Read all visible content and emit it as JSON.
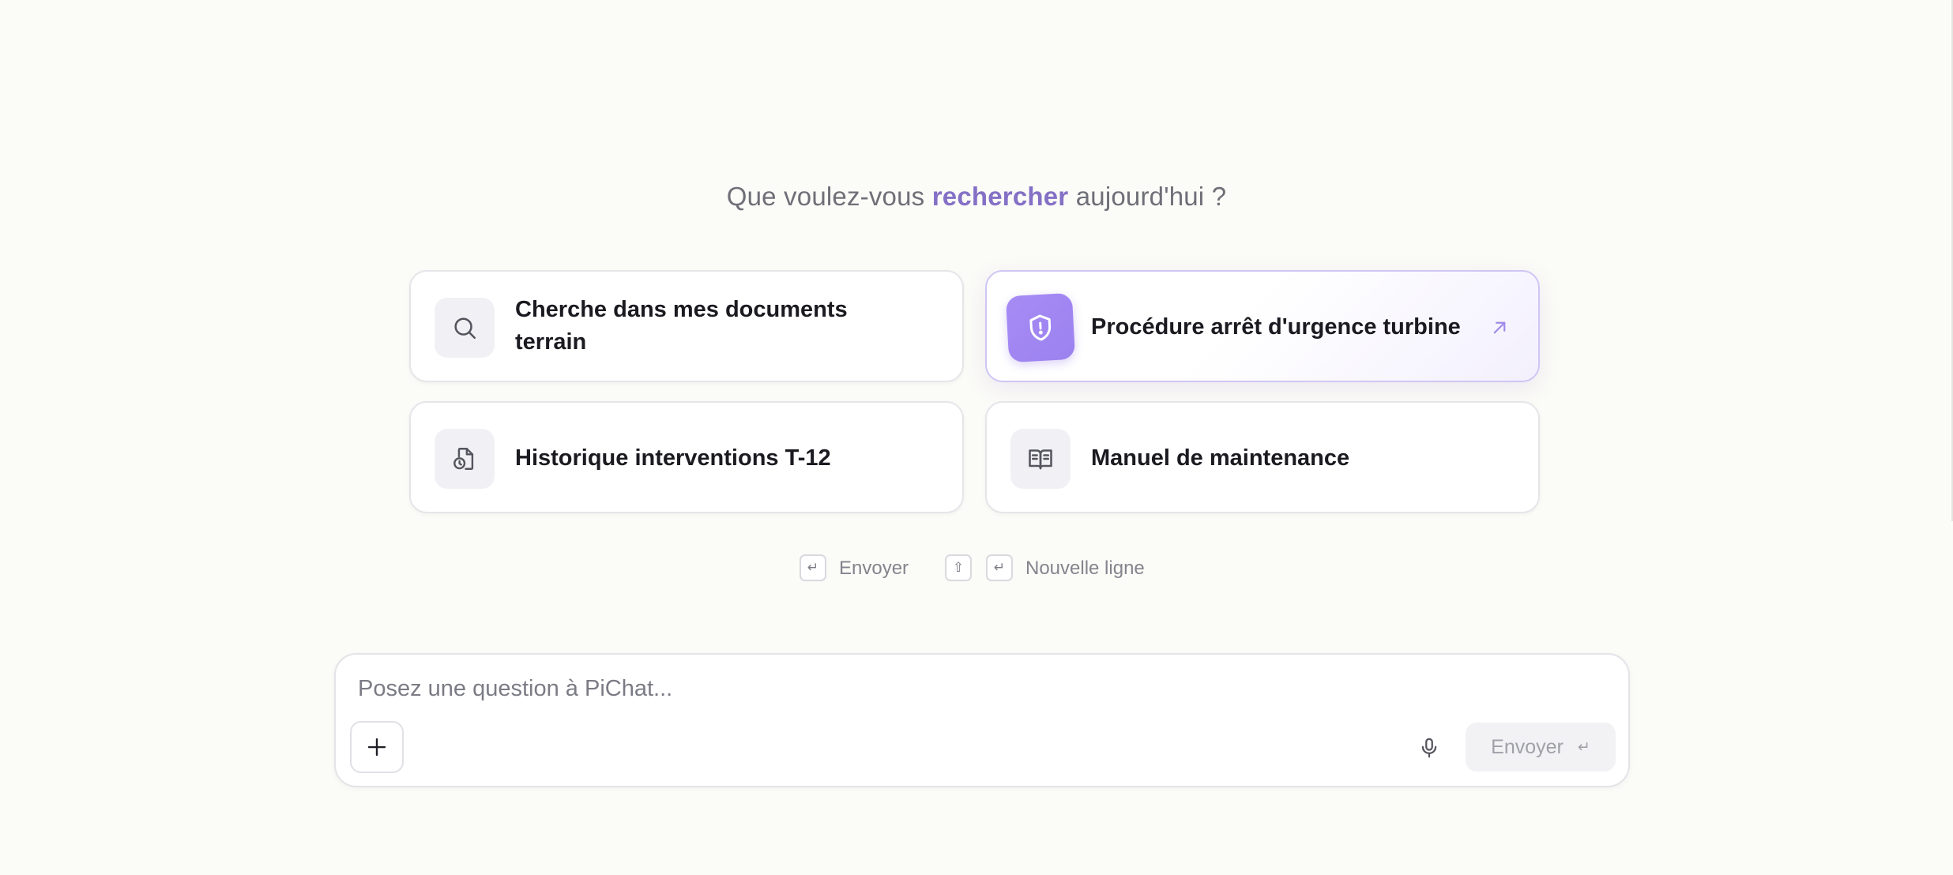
{
  "headline": {
    "prefix": "Que voulez-vous",
    "accent": "rechercher",
    "suffix": "aujourd'hui ?"
  },
  "suggestions": [
    {
      "label": "Cherche dans mes documents terrain",
      "icon": "search-icon"
    },
    {
      "label": "Procédure arrêt d'urgence turbine",
      "icon": "shield-alert-icon",
      "highlighted": true
    },
    {
      "label": "Historique interventions T-12",
      "icon": "file-history-icon"
    },
    {
      "label": "Manuel de maintenance",
      "icon": "open-book-icon"
    }
  ],
  "shortcuts": {
    "send_label": "Envoyer",
    "newline_label": "Nouvelle ligne",
    "enter_key": "↵",
    "shift_key": "⇧"
  },
  "composer": {
    "placeholder": "Posez une question à PiChat...",
    "value": "",
    "send_label": "Envoyer",
    "send_key": "↵"
  },
  "colors": {
    "background": "#fbfbf7",
    "accent": "#8470c6",
    "highlight_icon": "#a78bf5"
  }
}
